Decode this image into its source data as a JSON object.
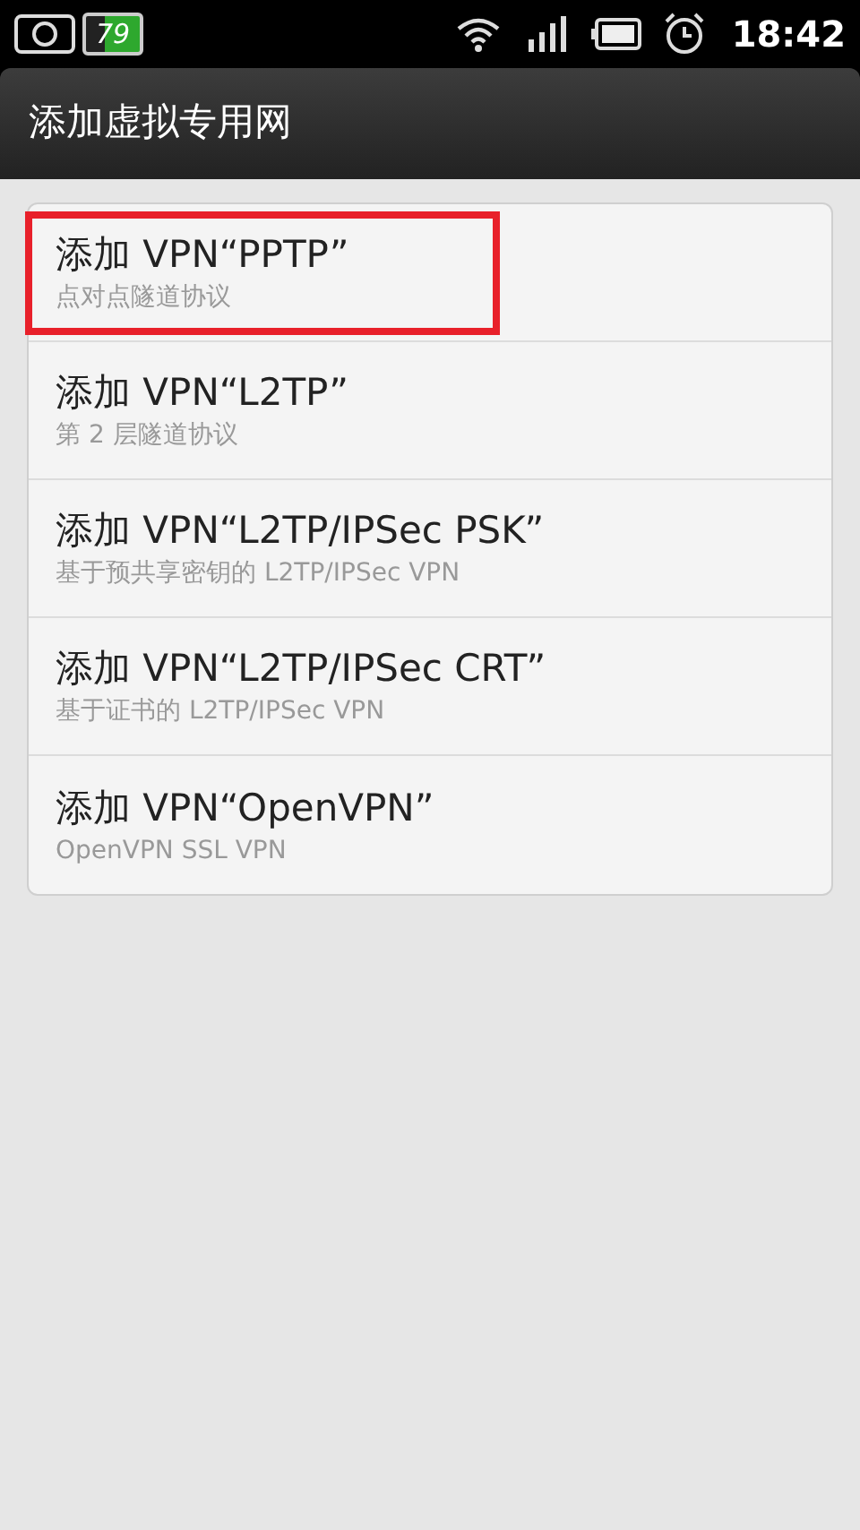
{
  "status_bar": {
    "battery_percent": "79",
    "time": "18:42"
  },
  "title": "添加虚拟专用网",
  "items": [
    {
      "title": "添加 VPN“PPTP”",
      "subtitle": "点对点隧道协议",
      "highlighted": true
    },
    {
      "title": "添加 VPN“L2TP”",
      "subtitle": "第 2 层隧道协议",
      "highlighted": false
    },
    {
      "title": "添加 VPN“L2TP/IPSec PSK”",
      "subtitle": "基于预共享密钥的 L2TP/IPSec VPN",
      "highlighted": false
    },
    {
      "title": "添加 VPN“L2TP/IPSec CRT”",
      "subtitle": "基于证书的 L2TP/IPSec VPN",
      "highlighted": false
    },
    {
      "title": "添加 VPN“OpenVPN”",
      "subtitle": "OpenVPN SSL VPN",
      "highlighted": false
    }
  ]
}
